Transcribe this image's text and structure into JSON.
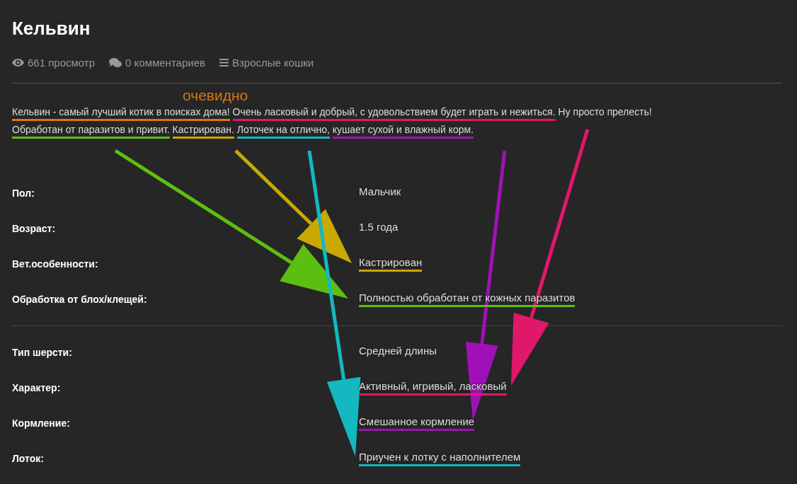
{
  "title": "Кельвин",
  "meta": [
    {
      "kind": "views",
      "text": "661 просмотр"
    },
    {
      "kind": "comments",
      "text": "0 комментариев"
    },
    {
      "kind": "category",
      "text": "Взрослые кошки"
    }
  ],
  "annotation_label": {
    "text": "очевидно",
    "color": "#d9770f"
  },
  "description": [
    [
      {
        "text": "Кельвин - самый лучший котик в поисках дома!",
        "color": "#d9770f"
      },
      {
        "text": "Очень ласковый и добрый, с удовольствием будет играть и нежиться.",
        "color": "#e0186a"
      },
      {
        "text": "Ну просто прелесть!"
      }
    ],
    [
      {
        "text": "Обработан от паразитов и привит.",
        "color": "#5cbf0f"
      },
      {
        "text": "Кастрирован.",
        "color": "#c9a800"
      },
      {
        "text": "Лоточек на отлично,",
        "color": "#14b8c0"
      },
      {
        "text": "кушает сухой и влажный корм.",
        "color": "#a010b8"
      }
    ]
  ],
  "sections": [
    [
      {
        "label": "Пол:",
        "value": "Мальчик"
      },
      {
        "label": "Возраст:",
        "value": "1.5 года"
      },
      {
        "label": "Вет.особенности:",
        "value": "Кастрирован",
        "color": "#c9a800"
      },
      {
        "label": "Обработка от блох/клещей:",
        "value": "Полностью обработан от кожных паразитов",
        "color": "#5cbf0f"
      }
    ],
    [
      {
        "label": "Тип шерсти:",
        "value": "Средней длины"
      },
      {
        "label": "Характер:",
        "value": "Активный, игривый, ласковый",
        "color": "#e0186a"
      },
      {
        "label": "Кормление:",
        "value": "Смешанное кормление",
        "color": "#a010b8"
      },
      {
        "label": "Лоток:",
        "value": "Приучен к лотку с наполнителем",
        "color": "#14b8c0"
      }
    ]
  ]
}
